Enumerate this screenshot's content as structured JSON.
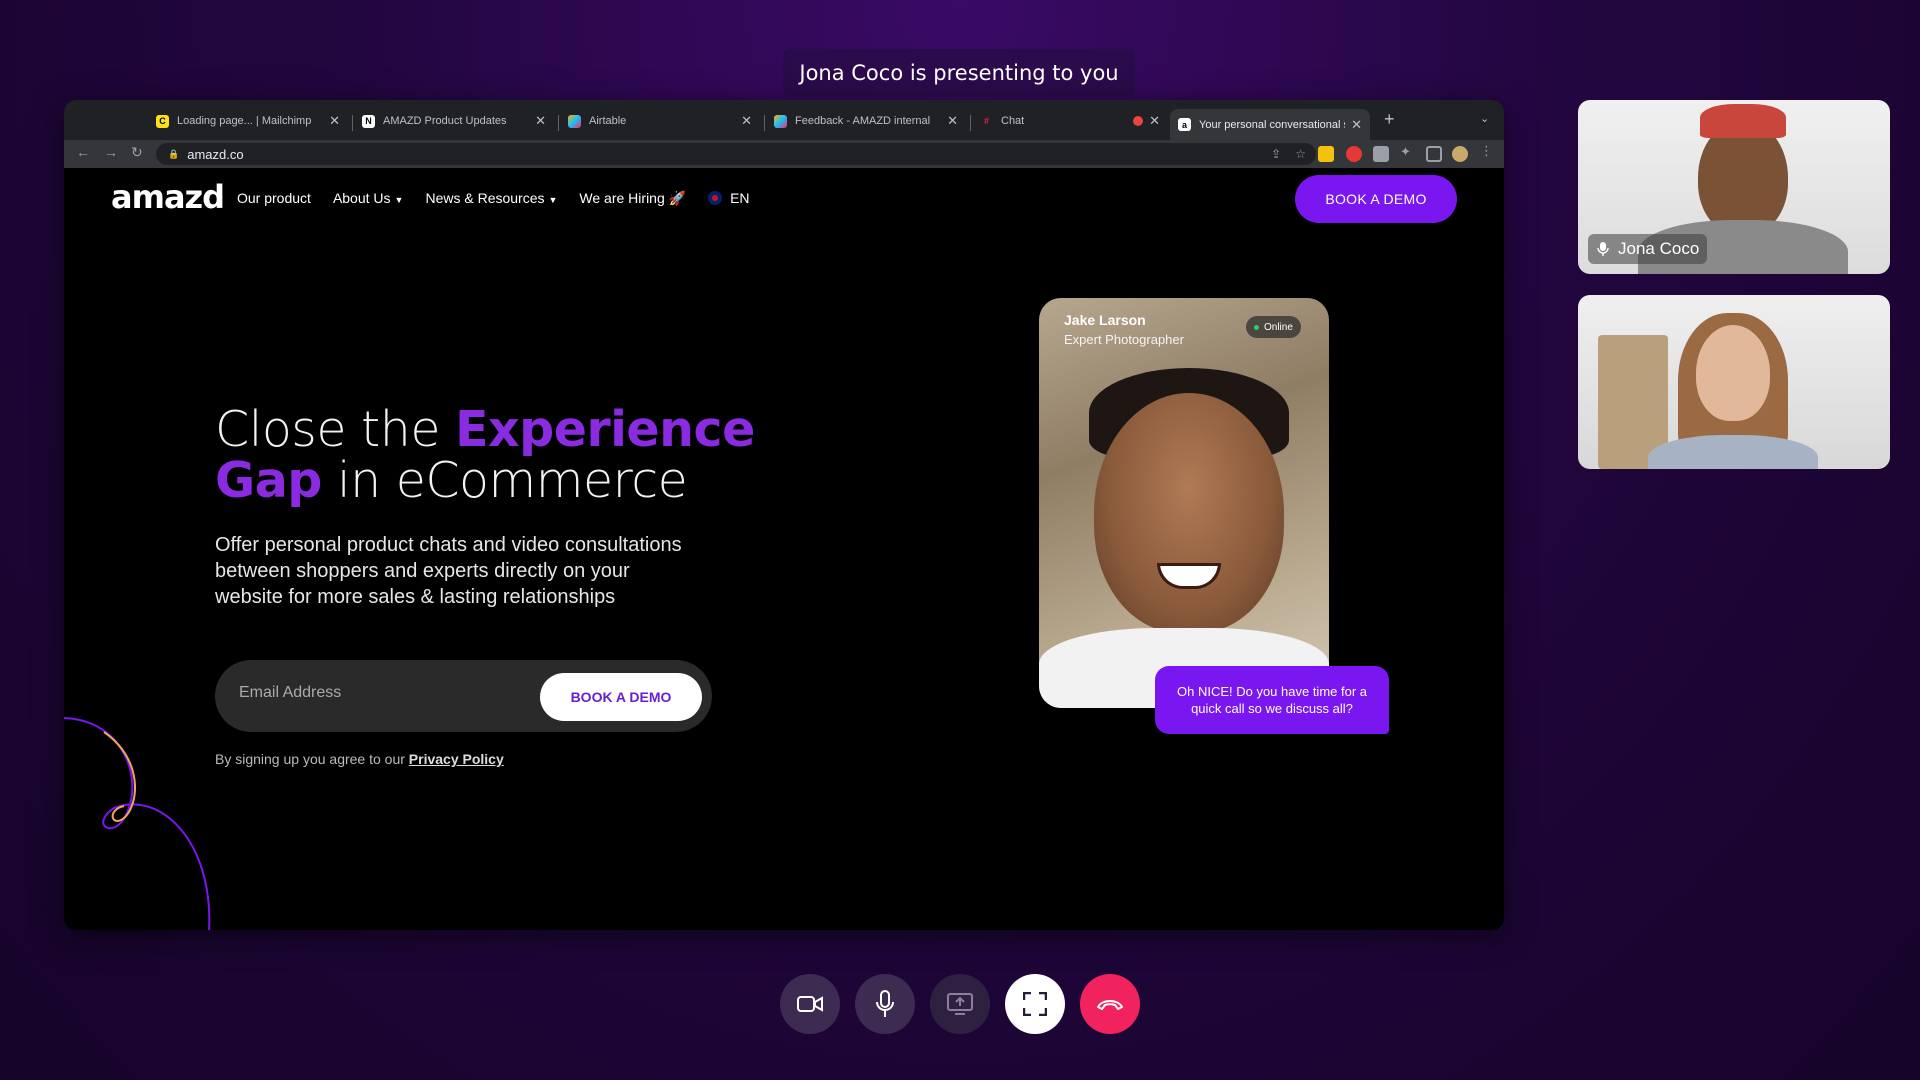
{
  "banner": {
    "text": "Jona Coco is presenting to you"
  },
  "browser": {
    "tabs": [
      {
        "label": "Loading page... | Mailchimp",
        "favicon_color": "#ffe01b"
      },
      {
        "label": "AMAZD Product Updates",
        "favicon_color": "#ffffff"
      },
      {
        "label": "Airtable",
        "favicon_color": "#fcb400"
      },
      {
        "label": "Feedback - AMAZD internal",
        "favicon_color": "#fcb400"
      },
      {
        "label": "Chat",
        "favicon_color": "#e01e5a"
      },
      {
        "label": "Your personal conversational s",
        "favicon_color": "#ffffff",
        "active": true
      }
    ],
    "url": "amazd.co"
  },
  "site": {
    "logo": "amazd",
    "nav": {
      "our_product": "Our product",
      "about_us": "About Us",
      "news": "News & Resources",
      "hiring": "We are Hiring 🚀",
      "language": "EN"
    },
    "book_demo_top": "BOOK A DEMO",
    "headline": {
      "part1": "Close the ",
      "highlight1": "Experience",
      "highlight2": "Gap",
      "part2": " in eCommerce"
    },
    "subtitle": "Offer personal product chats and video consultations between shoppers and experts directly on your website for more sales & lasting relationships",
    "email_placeholder": "Email Address",
    "book_demo_form": "BOOK A DEMO",
    "privacy_prefix": "By signing up you agree to our ",
    "privacy_link": "Privacy Policy",
    "expert_card": {
      "name": "Jake Larson",
      "role": "Expert Photographer",
      "status": "Online"
    },
    "chat_bubble": "Oh NICE! Do you have time for a quick call so we discuss all?",
    "accent_color": "#7a16f0"
  },
  "participants": [
    {
      "name": "Jona Coco",
      "mic": "microphone-icon"
    },
    {
      "name": ""
    }
  ],
  "controls": [
    "camera-icon",
    "microphone-icon",
    "share-screen-icon",
    "fullscreen-icon",
    "hang-up-icon"
  ]
}
